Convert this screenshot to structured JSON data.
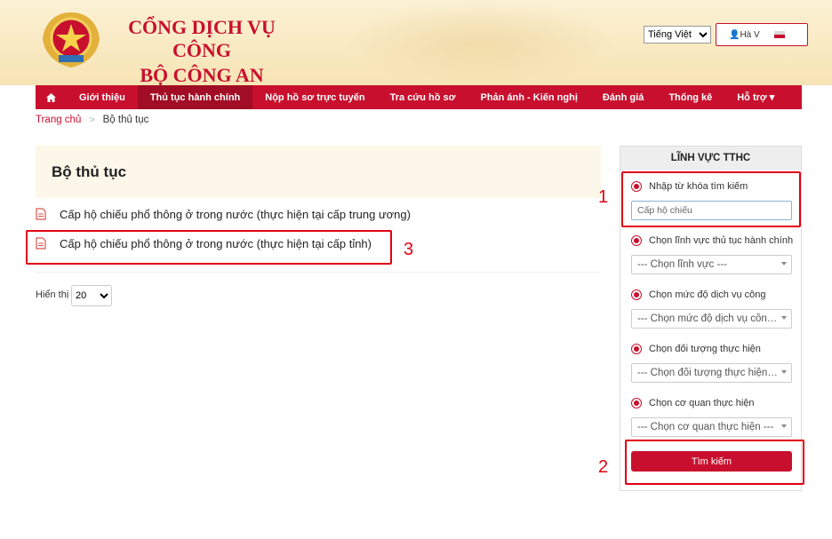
{
  "header": {
    "site_title_line1": "CỔNG DỊCH VỤ CÔNG",
    "site_title_line2": "BỘ CÔNG AN",
    "language": "Tiếng Việt",
    "user_name": "Hà V",
    "brand_color": "#c8102e"
  },
  "nav": {
    "home_icon": "home-icon",
    "items": [
      {
        "label": "Giới thiệu"
      },
      {
        "label": "Thủ tục hành chính",
        "active": true
      },
      {
        "label": "Nộp hồ sơ trực tuyến"
      },
      {
        "label": "Tra cứu hồ sơ"
      },
      {
        "label": "Phản ánh - Kiến nghị"
      },
      {
        "label": "Đánh giá"
      },
      {
        "label": "Thống kê"
      },
      {
        "label": "Hỗ trợ ▾"
      }
    ]
  },
  "breadcrumb": {
    "home": "Trang chủ",
    "current": "Bộ thủ tục"
  },
  "main": {
    "title": "Bộ thủ tục",
    "procedures": [
      {
        "label": "Cấp hộ chiếu phổ thông ở trong nước (thực hiện tại cấp trung ương)"
      },
      {
        "label": "Cấp hộ chiếu phổ thông ở trong nước (thực hiện tại cấp tỉnh)"
      }
    ],
    "per_page_label": "Hiển thị",
    "per_page_value": "20"
  },
  "panel": {
    "title": "LĨNH VỰC TTHC",
    "keyword_label": "Nhập từ khóa tìm kiếm",
    "keyword_value": "Cấp hộ chiếu",
    "field_label": "Chọn lĩnh vực thủ tục hành chính",
    "field_value": "--- Chọn lĩnh vực ---",
    "level_label": "Chọn mức độ dịch vụ công",
    "level_value": "--- Chọn mức độ dịch vụ công ---",
    "subject_label": "Chọn đối tượng thực hiện",
    "subject_value": "--- Chọn đối tượng thực hiện ---",
    "agency_label": "Chọn cơ quan thực hiện",
    "agency_value": "--- Chọn cơ quan thực hiện ---",
    "search_label": "Tìm kiếm"
  },
  "annotations": {
    "n1": "1",
    "n2": "2",
    "n3": "3"
  }
}
